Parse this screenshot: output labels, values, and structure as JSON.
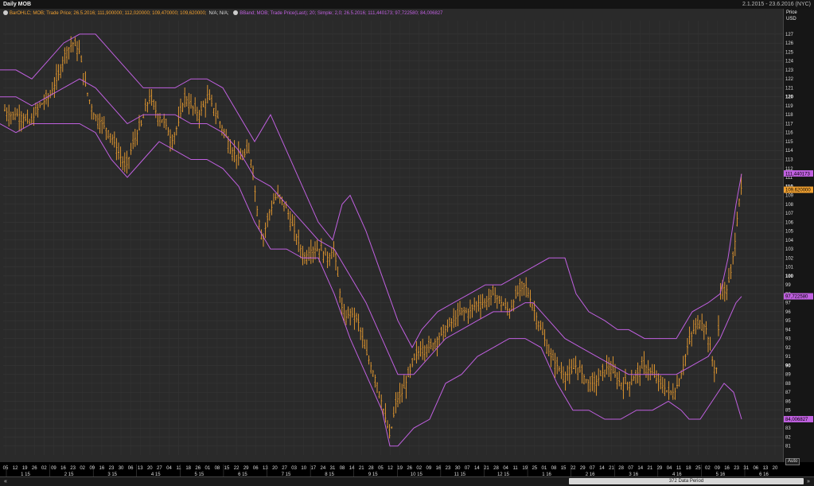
{
  "window": {
    "title": "Daily MOB",
    "date_range": "2.1.2015 - 23.6.2016 (NYC)"
  },
  "legend": {
    "bar_series": "BarOHLC; MOB; Trade Price; 26.5.2016; 111,900000; 112,020000; 109,470000; 109,620000;",
    "bar_na": "N/A; N/A;",
    "bband_series": "BBand; MOB; Trade Price(Last); 20; Simple; 2,0; 26.5.2016; 111,440173; 97,722580; 84,006827"
  },
  "axis": {
    "price_label": "Price",
    "currency_label": "USD",
    "auto_label": "Auto"
  },
  "scroll": {
    "period_label": "372 Data Period",
    "left_icon": "double-chevron-left-icon",
    "right_icon": "double-chevron-right-icon"
  },
  "colors": {
    "bars": "#f0a030",
    "bands": "#c060e0",
    "last_price_tag": "#f0a030",
    "band_tag": "#c060e0"
  },
  "chart_data": {
    "type": "ohlc",
    "ylim": [
      80,
      128.5
    ],
    "yticks": [
      81,
      82,
      83,
      84,
      85,
      86,
      87,
      88,
      89,
      90,
      91,
      92,
      93,
      94,
      95,
      96,
      97,
      98,
      99,
      100,
      101,
      102,
      103,
      104,
      105,
      106,
      107,
      108,
      109,
      110,
      111,
      112,
      113,
      114,
      115,
      116,
      117,
      118,
      119,
      120,
      121,
      122,
      123,
      124,
      125,
      126,
      127
    ],
    "ybold": [
      90,
      100,
      110,
      120
    ],
    "day_labels": [
      "05",
      "12",
      "19",
      "26",
      "02",
      "09",
      "16",
      "23",
      "02",
      "09",
      "16",
      "23",
      "30",
      "06",
      "13",
      "20",
      "27",
      "04",
      "11",
      "18",
      "26",
      "01",
      "08",
      "15",
      "22",
      "29",
      "06",
      "13",
      "20",
      "27",
      "03",
      "10",
      "17",
      "24",
      "31",
      "08",
      "14",
      "21",
      "28",
      "05",
      "12",
      "19",
      "26",
      "02",
      "09",
      "16",
      "23",
      "30",
      "07",
      "14",
      "21",
      "28",
      "04",
      "11",
      "19",
      "25",
      "01",
      "08",
      "15",
      "22",
      "29",
      "07",
      "14",
      "21",
      "28",
      "07",
      "14",
      "21",
      "29",
      "04",
      "11",
      "18",
      "25",
      "02",
      "09",
      "16",
      "23",
      "31",
      "06",
      "13",
      "20"
    ],
    "month_labels": [
      "1 15",
      "2 15",
      "3 15",
      "4 15",
      "5 15",
      "6 15",
      "7 15",
      "8 15",
      "9 15",
      "10 15",
      "11 15",
      "12 15",
      "1 16",
      "2 16",
      "3 16",
      "4 16",
      "5 16",
      "6 16"
    ],
    "price_tags": [
      {
        "label": "111,440173",
        "value": 111.44,
        "kind": "band"
      },
      {
        "label": "109,620000",
        "value": 109.62,
        "kind": "last"
      },
      {
        "label": "97,722580",
        "value": 97.72,
        "kind": "band"
      },
      {
        "label": "84,006827",
        "value": 84.0,
        "kind": "band"
      }
    ],
    "close_path": [
      [
        0,
        119
      ],
      [
        12,
        118
      ],
      [
        25,
        118
      ],
      [
        38,
        117
      ],
      [
        50,
        119
      ],
      [
        62,
        120
      ],
      [
        72,
        122
      ],
      [
        82,
        125
      ],
      [
        92,
        126
      ],
      [
        100,
        125
      ],
      [
        108,
        121
      ],
      [
        118,
        118
      ],
      [
        128,
        117
      ],
      [
        138,
        116
      ],
      [
        148,
        114
      ],
      [
        158,
        112
      ],
      [
        168,
        115
      ],
      [
        178,
        117
      ],
      [
        188,
        120
      ],
      [
        198,
        118
      ],
      [
        208,
        117
      ],
      [
        216,
        115
      ],
      [
        224,
        117
      ],
      [
        232,
        120
      ],
      [
        240,
        119
      ],
      [
        250,
        118
      ],
      [
        262,
        120
      ],
      [
        272,
        118
      ],
      [
        282,
        116
      ],
      [
        292,
        114
      ],
      [
        302,
        113
      ],
      [
        312,
        114
      ],
      [
        318,
        112
      ],
      [
        322,
        108
      ],
      [
        330,
        104
      ],
      [
        338,
        107
      ],
      [
        348,
        109
      ],
      [
        358,
        108
      ],
      [
        366,
        106
      ],
      [
        374,
        104
      ],
      [
        382,
        102
      ],
      [
        392,
        103
      ],
      [
        402,
        103
      ],
      [
        412,
        102
      ],
      [
        420,
        103
      ],
      [
        426,
        99
      ],
      [
        432,
        95
      ],
      [
        440,
        96
      ],
      [
        450,
        95
      ],
      [
        458,
        92
      ],
      [
        466,
        90
      ],
      [
        474,
        88
      ],
      [
        482,
        85
      ],
      [
        490,
        82
      ],
      [
        498,
        86
      ],
      [
        506,
        87
      ],
      [
        514,
        89
      ],
      [
        522,
        91
      ],
      [
        530,
        92
      ],
      [
        540,
        92
      ],
      [
        550,
        93
      ],
      [
        560,
        94
      ],
      [
        570,
        95
      ],
      [
        580,
        96
      ],
      [
        590,
        96
      ],
      [
        600,
        97
      ],
      [
        610,
        97
      ],
      [
        620,
        98
      ],
      [
        630,
        97
      ],
      [
        640,
        96
      ],
      [
        650,
        98
      ],
      [
        660,
        99
      ],
      [
        668,
        97
      ],
      [
        676,
        95
      ],
      [
        684,
        93
      ],
      [
        692,
        91
      ],
      [
        700,
        90
      ],
      [
        708,
        89
      ],
      [
        716,
        89
      ],
      [
        724,
        90
      ],
      [
        732,
        89
      ],
      [
        740,
        88
      ],
      [
        748,
        88
      ],
      [
        756,
        89
      ],
      [
        764,
        90
      ],
      [
        772,
        89
      ],
      [
        780,
        88
      ],
      [
        790,
        88
      ],
      [
        800,
        89
      ],
      [
        810,
        90
      ],
      [
        820,
        89
      ],
      [
        830,
        88
      ],
      [
        840,
        87
      ],
      [
        848,
        87
      ],
      [
        856,
        89
      ],
      [
        864,
        92
      ],
      [
        872,
        94
      ],
      [
        880,
        95
      ],
      [
        888,
        94
      ],
      [
        894,
        91
      ],
      [
        900,
        89
      ],
      [
        906,
        99
      ],
      [
        912,
        98
      ],
      [
        918,
        100
      ],
      [
        924,
        104
      ],
      [
        928,
        108
      ],
      [
        932,
        110
      ]
    ],
    "bands_upper": [
      [
        0,
        123
      ],
      [
        20,
        123
      ],
      [
        40,
        122
      ],
      [
        60,
        124
      ],
      [
        80,
        126
      ],
      [
        100,
        127
      ],
      [
        120,
        127
      ],
      [
        130,
        126
      ],
      [
        140,
        125
      ],
      [
        150,
        124
      ],
      [
        160,
        123
      ],
      [
        170,
        122
      ],
      [
        180,
        121
      ],
      [
        200,
        121
      ],
      [
        220,
        121
      ],
      [
        240,
        122
      ],
      [
        260,
        122
      ],
      [
        280,
        121
      ],
      [
        300,
        118
      ],
      [
        320,
        115
      ],
      [
        340,
        118
      ],
      [
        360,
        114
      ],
      [
        380,
        110
      ],
      [
        400,
        106
      ],
      [
        418,
        104
      ],
      [
        430,
        108
      ],
      [
        440,
        109
      ],
      [
        460,
        105
      ],
      [
        480,
        100
      ],
      [
        500,
        95
      ],
      [
        518,
        92
      ],
      [
        530,
        94
      ],
      [
        550,
        96
      ],
      [
        570,
        97
      ],
      [
        590,
        98
      ],
      [
        610,
        99
      ],
      [
        630,
        99
      ],
      [
        650,
        100
      ],
      [
        670,
        101
      ],
      [
        690,
        102
      ],
      [
        710,
        102
      ],
      [
        724,
        98
      ],
      [
        740,
        96
      ],
      [
        760,
        95
      ],
      [
        776,
        94
      ],
      [
        790,
        94
      ],
      [
        810,
        93
      ],
      [
        830,
        93
      ],
      [
        850,
        93
      ],
      [
        870,
        96
      ],
      [
        890,
        97
      ],
      [
        905,
        98
      ],
      [
        915,
        102
      ],
      [
        925,
        108
      ],
      [
        932,
        111.4
      ]
    ],
    "bands_mid": [
      [
        0,
        120
      ],
      [
        20,
        120
      ],
      [
        40,
        119
      ],
      [
        60,
        120
      ],
      [
        80,
        121
      ],
      [
        100,
        122
      ],
      [
        120,
        121
      ],
      [
        140,
        119
      ],
      [
        160,
        117
      ],
      [
        180,
        118
      ],
      [
        200,
        118
      ],
      [
        220,
        118
      ],
      [
        240,
        117
      ],
      [
        260,
        117
      ],
      [
        280,
        116
      ],
      [
        300,
        114
      ],
      [
        320,
        111
      ],
      [
        340,
        110
      ],
      [
        360,
        108
      ],
      [
        380,
        106
      ],
      [
        400,
        104
      ],
      [
        420,
        103
      ],
      [
        440,
        100
      ],
      [
        460,
        97
      ],
      [
        480,
        93
      ],
      [
        500,
        89
      ],
      [
        520,
        89
      ],
      [
        540,
        91
      ],
      [
        560,
        93
      ],
      [
        580,
        94
      ],
      [
        600,
        95
      ],
      [
        620,
        96
      ],
      [
        640,
        96
      ],
      [
        660,
        97
      ],
      [
        670,
        97
      ],
      [
        690,
        95
      ],
      [
        710,
        93
      ],
      [
        730,
        92
      ],
      [
        750,
        91
      ],
      [
        770,
        90
      ],
      [
        790,
        89
      ],
      [
        810,
        89
      ],
      [
        830,
        89
      ],
      [
        850,
        89
      ],
      [
        870,
        90
      ],
      [
        890,
        91
      ],
      [
        905,
        93
      ],
      [
        915,
        95
      ],
      [
        925,
        97
      ],
      [
        932,
        97.7
      ]
    ],
    "bands_lower": [
      [
        0,
        117
      ],
      [
        20,
        116
      ],
      [
        40,
        117
      ],
      [
        60,
        117
      ],
      [
        80,
        117
      ],
      [
        100,
        117
      ],
      [
        120,
        116
      ],
      [
        140,
        113
      ],
      [
        160,
        111
      ],
      [
        180,
        113
      ],
      [
        200,
        115
      ],
      [
        220,
        114
      ],
      [
        240,
        113
      ],
      [
        260,
        113
      ],
      [
        280,
        112
      ],
      [
        300,
        110
      ],
      [
        320,
        106
      ],
      [
        340,
        103
      ],
      [
        360,
        103
      ],
      [
        380,
        102
      ],
      [
        400,
        102
      ],
      [
        420,
        98
      ],
      [
        440,
        93
      ],
      [
        460,
        89
      ],
      [
        480,
        85
      ],
      [
        490,
        81
      ],
      [
        500,
        81
      ],
      [
        520,
        83
      ],
      [
        540,
        84
      ],
      [
        560,
        88
      ],
      [
        580,
        89
      ],
      [
        600,
        91
      ],
      [
        620,
        92
      ],
      [
        640,
        93
      ],
      [
        660,
        93
      ],
      [
        680,
        92
      ],
      [
        700,
        88
      ],
      [
        720,
        85
      ],
      [
        740,
        85
      ],
      [
        760,
        84
      ],
      [
        780,
        84
      ],
      [
        800,
        85
      ],
      [
        820,
        85
      ],
      [
        840,
        86
      ],
      [
        856,
        85
      ],
      [
        866,
        84
      ],
      [
        880,
        84
      ],
      [
        895,
        86
      ],
      [
        910,
        88
      ],
      [
        922,
        87
      ],
      [
        932,
        84
      ]
    ]
  }
}
